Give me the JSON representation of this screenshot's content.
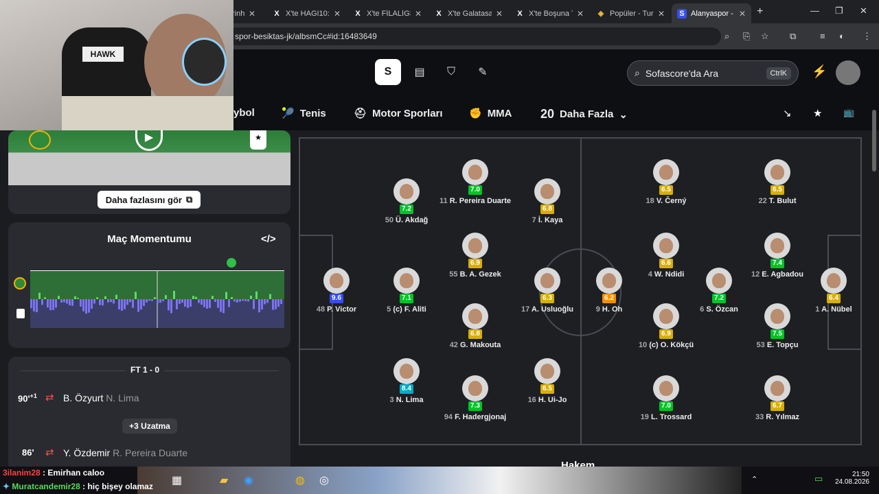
{
  "browser": {
    "tabs": [
      {
        "label": "rinh",
        "icon": ""
      },
      {
        "label": "X'te HAGI10:",
        "icon": "X"
      },
      {
        "label": "X'te FİLALİGS",
        "icon": "X"
      },
      {
        "label": "X'te Galatasa",
        "icon": "X"
      },
      {
        "label": "X'te Boşuna T",
        "icon": "X"
      },
      {
        "label": "Popüler - Tur",
        "icon": "◈"
      },
      {
        "label": "Alanyaspor -",
        "icon": "S"
      }
    ],
    "url": "spor-besiktas-jk/albsmCc#id:16483649"
  },
  "header": {
    "search_placeholder": "Sofascore'da Ara",
    "shortcut": "CtrlK",
    "sports": [
      "ybol",
      "Tenis",
      "Motor Sporları",
      "MMA",
      "Daha Fazla"
    ],
    "more_count": "20"
  },
  "left": {
    "more_button": "Daha fazlasını gör",
    "momentum_title": "Maç Momentumu",
    "embed_label": "</>",
    "result": "FT 1 - 0",
    "events": [
      {
        "minute": "90'",
        "extra": "+1",
        "in": "B. Özyurt",
        "out": "N. Lima"
      },
      {
        "minute": "86'",
        "extra": "",
        "in": "Y. Özdemir",
        "out": "R. Pereira Duarte"
      }
    ],
    "extra_time": "+3 Uzatma"
  },
  "lineup": {
    "home": [
      {
        "num": "48",
        "name": "P. Victor",
        "rating": "9.6",
        "color": "#374df5"
      },
      {
        "num": "50",
        "name": "Ü. Akdağ",
        "rating": "7.2",
        "color": "#00c424"
      },
      {
        "num": "5",
        "name": "(c) F. Aliti",
        "rating": "7.1",
        "color": "#00c424"
      },
      {
        "num": "3",
        "name": "N. Lima",
        "rating": "8.4",
        "color": "#00adc4"
      },
      {
        "num": "11",
        "name": "R. Pereira Duarte",
        "rating": "7.0",
        "color": "#00c424"
      },
      {
        "num": "55",
        "name": "B. A. Gezek",
        "rating": "6.9",
        "color": "#d9af00"
      },
      {
        "num": "42",
        "name": "G. Makouta",
        "rating": "6.8",
        "color": "#d9af00"
      },
      {
        "num": "94",
        "name": "F. Hadergjonaj",
        "rating": "7.3",
        "color": "#00c424"
      },
      {
        "num": "7",
        "name": "İ. Kaya",
        "rating": "6.8",
        "color": "#d9af00"
      },
      {
        "num": "17",
        "name": "A. Usluoğlu",
        "rating": "6.3",
        "color": "#d9af00"
      },
      {
        "num": "16",
        "name": "H. Ui-Jo",
        "rating": "6.5",
        "color": "#d9af00"
      }
    ],
    "away": [
      {
        "num": "9",
        "name": "H. Oh",
        "rating": "6.2",
        "color": "#fa8c00"
      },
      {
        "num": "18",
        "name": "V. Černý",
        "rating": "6.5",
        "color": "#d9af00"
      },
      {
        "num": "4",
        "name": "W. Ndidi",
        "rating": "6.6",
        "color": "#d9af00"
      },
      {
        "num": "10",
        "name": "(c) O. Kökçü",
        "rating": "6.9",
        "color": "#d9af00"
      },
      {
        "num": "19",
        "name": "L. Trossard",
        "rating": "7.0",
        "color": "#00c424"
      },
      {
        "num": "6",
        "name": "S. Özcan",
        "rating": "7.2",
        "color": "#00c424"
      },
      {
        "num": "22",
        "name": "T. Bulut",
        "rating": "6.5",
        "color": "#d9af00"
      },
      {
        "num": "12",
        "name": "E. Agbadou",
        "rating": "7.4",
        "color": "#00c424"
      },
      {
        "num": "53",
        "name": "E. Topçu",
        "rating": "7.5",
        "color": "#00c424"
      },
      {
        "num": "33",
        "name": "R. Yılmaz",
        "rating": "6.7",
        "color": "#d9af00"
      },
      {
        "num": "1",
        "name": "A. Nübel",
        "rating": "6.4",
        "color": "#d9af00"
      }
    ],
    "referee_heading": "Hakem"
  },
  "chat": [
    {
      "user": "3ilanim28",
      "msg": "Emirhan caloo"
    },
    {
      "user": "Muratcandemir28",
      "msg": "hiç bişey olamaz"
    }
  ],
  "taskbar": {
    "time": "21:50",
    "date": "24.08.2026"
  }
}
